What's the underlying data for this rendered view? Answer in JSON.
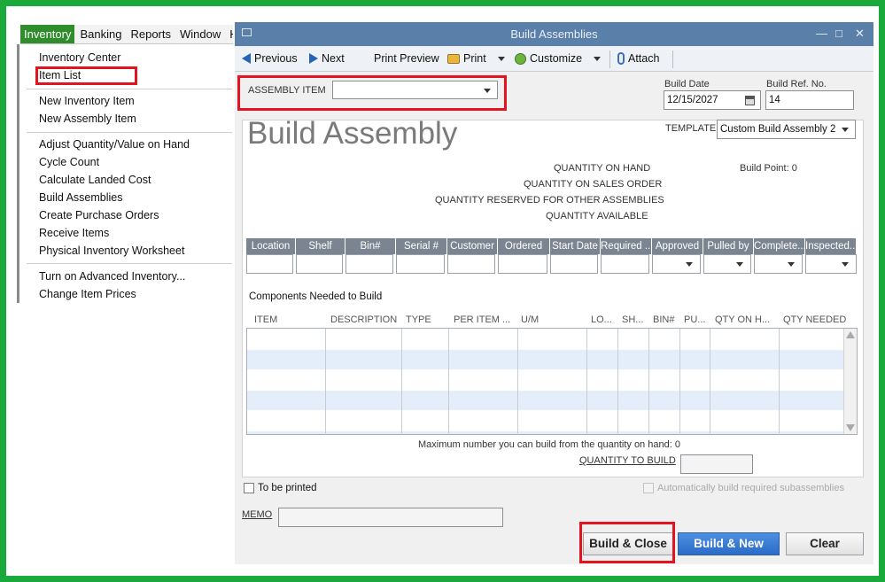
{
  "menubar": {
    "items": [
      "Inventory",
      "Banking",
      "Reports",
      "Window",
      "H"
    ]
  },
  "inventory_menu": {
    "items": [
      "Inventory Center",
      "Item List",
      "New Inventory Item",
      "New Assembly Item",
      "Adjust Quantity/Value on Hand",
      "Cycle Count",
      "Calculate Landed Cost",
      "Build Assemblies",
      "Create Purchase Orders",
      "Receive Items",
      "Physical Inventory Worksheet",
      "Turn on Advanced Inventory...",
      "Change Item Prices"
    ]
  },
  "window": {
    "title": "Build Assemblies",
    "controls": [
      "—",
      "□",
      "✕"
    ]
  },
  "toolbar": {
    "previous": "Previous",
    "next": "Next",
    "print_preview": "Print Preview",
    "print": "Print",
    "customize": "Customize",
    "attach": "Attach"
  },
  "header": {
    "assembly_item_label": "ASSEMBLY ITEM",
    "assembly_item_value": "",
    "build_date_label": "Build Date",
    "build_date_value": "12/15/2027",
    "build_ref_label": "Build Ref. No.",
    "build_ref_value": "14",
    "template_label": "TEMPLATE",
    "template_value": "Custom Build Assembly 2"
  },
  "form": {
    "title": "Build Assembly",
    "qty_on_hand": "QUANTITY ON HAND",
    "qty_on_sales_order": "QUANTITY ON SALES ORDER",
    "qty_reserved": "QUANTITY RESERVED FOR OTHER ASSEMBLIES",
    "qty_available": "QUANTITY AVAILABLE",
    "build_point": "Build Point: 0",
    "grid_headers": [
      "Location",
      "Shelf",
      "Bin#",
      "Serial #",
      "Customer",
      "Ordered",
      "Start Date",
      "Required ...",
      "Approved",
      "Pulled by",
      "Complete...",
      "Inspected..."
    ],
    "components_label": "Components Needed to Build",
    "component_columns": [
      "ITEM",
      "DESCRIPTION",
      "TYPE",
      "PER ITEM ...",
      "U/M",
      "LO...",
      "SH...",
      "BIN#",
      "PU...",
      "QTY ON H...",
      "QTY NEEDED"
    ],
    "max_build_text": "Maximum number you can build from the quantity on hand: 0",
    "qty_to_build_label": "QUANTITY TO BUILD",
    "qty_to_build_value": ""
  },
  "footer": {
    "to_be_printed": "To be printed",
    "auto_build": "Automatically build required subassemblies",
    "memo_label": "MEMO",
    "memo_value": "",
    "build_close": "Build & Close",
    "build_new": "Build & New",
    "clear": "Clear"
  },
  "colors": {
    "frame": "#1aaa3c",
    "highlight": "#e3141f",
    "titlebar": "#5a7fa8",
    "menu_active": "#2f8d2c",
    "primary_button": "#2a6cc7"
  }
}
